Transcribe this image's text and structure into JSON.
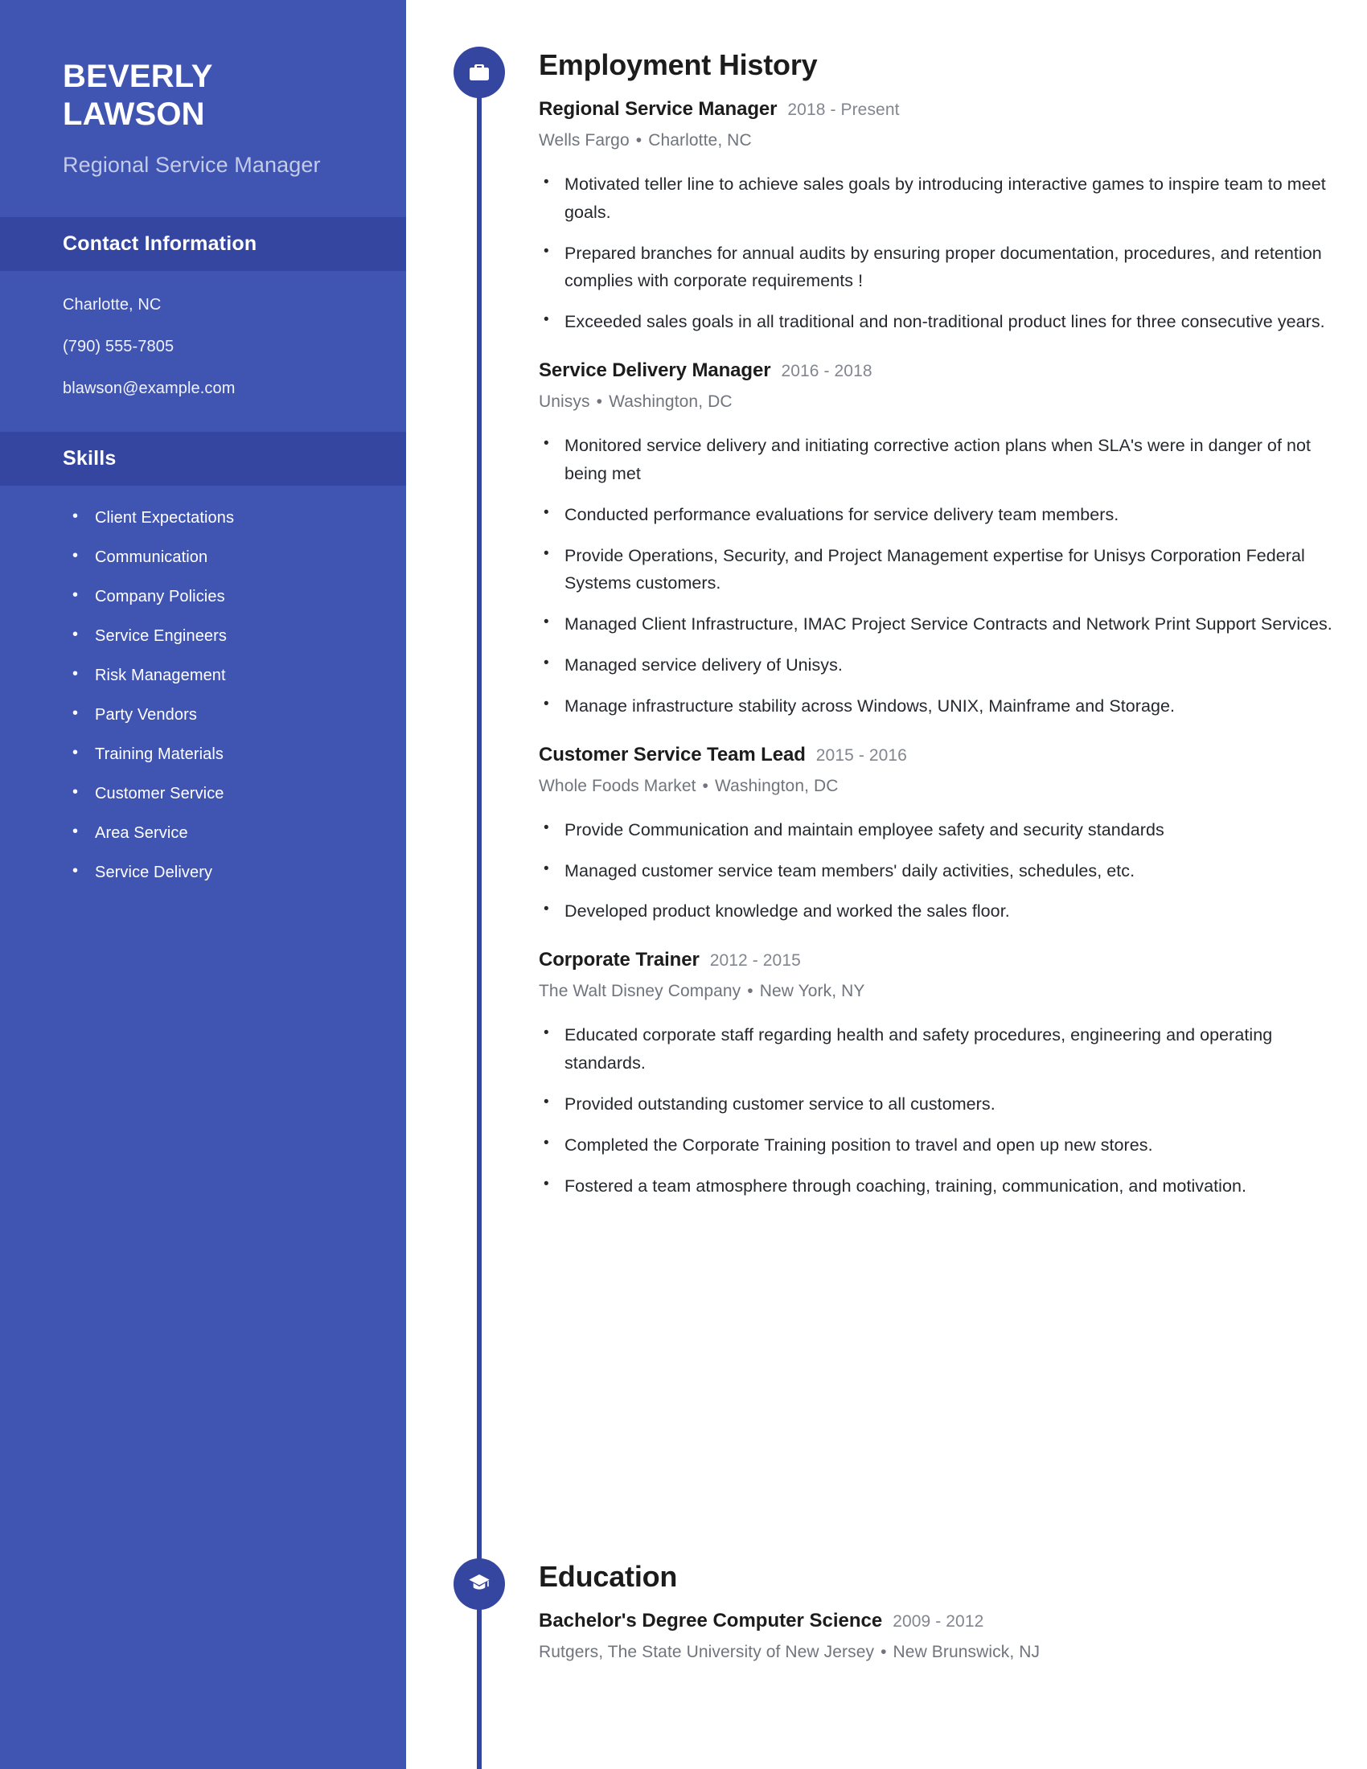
{
  "sidebar": {
    "name_line1": "BEVERLY",
    "name_line2": "LAWSON",
    "job_title": "Regional Service Manager",
    "contact_header": "Contact Information",
    "contact": [
      "Charlotte, NC",
      "(790) 555-7805",
      "blawson@example.com"
    ],
    "skills_header": "Skills",
    "skills": [
      "Client Expectations",
      "Communication",
      "Company Policies",
      "Service Engineers",
      "Risk Management",
      "Party Vendors",
      "Training Materials",
      "Customer Service",
      "Area Service",
      "Service Delivery"
    ]
  },
  "sections": {
    "employment": {
      "title": "Employment History",
      "icon": "briefcase-icon",
      "entries": [
        {
          "role": "Regional Service Manager",
          "dates": "2018 - Present",
          "company": "Wells Fargo",
          "location": "Charlotte, NC",
          "bullets": [
            "Motivated teller line to achieve sales goals by introducing interactive games to inspire team to meet goals.",
            "Prepared branches for annual audits by ensuring proper documentation, procedures, and retention complies with corporate requirements !",
            "Exceeded sales goals in all traditional and non-traditional product lines for three consecutive years."
          ]
        },
        {
          "role": "Service Delivery Manager",
          "dates": "2016 - 2018",
          "company": "Unisys",
          "location": "Washington, DC",
          "bullets": [
            "Monitored service delivery and initiating corrective action plans when SLA's were in danger of not being met",
            "Conducted performance evaluations for service delivery team members.",
            "Provide Operations, Security, and Project Management expertise for Unisys Corporation Federal Systems customers.",
            "Managed Client Infrastructure, IMAC Project Service Contracts and Network Print Support Services.",
            "Managed service delivery of Unisys.",
            "Manage infrastructure stability across Windows, UNIX, Mainframe and Storage."
          ]
        },
        {
          "role": "Customer Service Team Lead",
          "dates": "2015 - 2016",
          "company": "Whole Foods Market",
          "location": "Washington, DC",
          "bullets": [
            "Provide Communication and maintain employee safety and security standards",
            "Managed customer service team members' daily activities, schedules, etc.",
            "Developed product knowledge and worked the sales floor."
          ]
        },
        {
          "role": "Corporate Trainer",
          "dates": "2012 - 2015",
          "company": "The Walt Disney Company",
          "location": "New York, NY",
          "bullets": [
            "Educated corporate staff regarding health and safety procedures, engineering and operating standards.",
            "Provided outstanding customer service to all customers.",
            "Completed the Corporate Training position to travel and open up new stores.",
            "Fostered a team atmosphere through coaching, training, communication, and motivation."
          ]
        }
      ]
    },
    "education": {
      "title": "Education",
      "icon": "graduation-cap-icon",
      "entries": [
        {
          "degree": "Bachelor's Degree Computer Science",
          "dates": "2009 - 2012",
          "school": "Rutgers, The State University of New Jersey",
          "location": "New Brunswick, NJ"
        }
      ]
    }
  },
  "colors": {
    "sidebar_bg": "#4054b2",
    "sidebar_header_bg": "#3446a0",
    "accent": "#3446a0",
    "text_dark": "#1c1c1c",
    "text_muted": "#70747d"
  },
  "separator": "•"
}
